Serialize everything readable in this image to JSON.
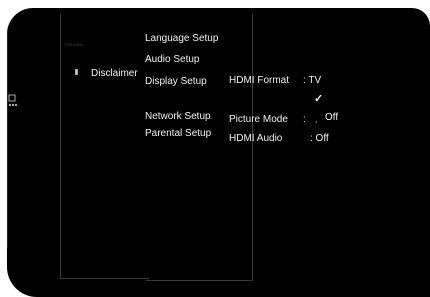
{
  "left_panel": {
    "faint_label": "TOSHIBA",
    "disclaimer": "Disclaimer"
  },
  "menu": {
    "items": [
      {
        "label": "Language Setup"
      },
      {
        "label": "Audio Setup"
      },
      {
        "label": "Display Setup"
      },
      {
        "label": "Network Setup"
      },
      {
        "label": "Parental Setup"
      }
    ]
  },
  "settings": {
    "hdmi_format_label": "HDMI Format",
    "hdmi_format_value": ": TV",
    "picture_mode_label": "Picture Mode",
    "picture_mode_value": "Off",
    "picture_mode_colon": ":",
    "hdmi_audio_label": "HDMI Audio",
    "hdmi_audio_value": ": Off",
    "checkmark": "✓"
  },
  "icons": {
    "disc": "disc-icon",
    "side": "remote-icon"
  }
}
